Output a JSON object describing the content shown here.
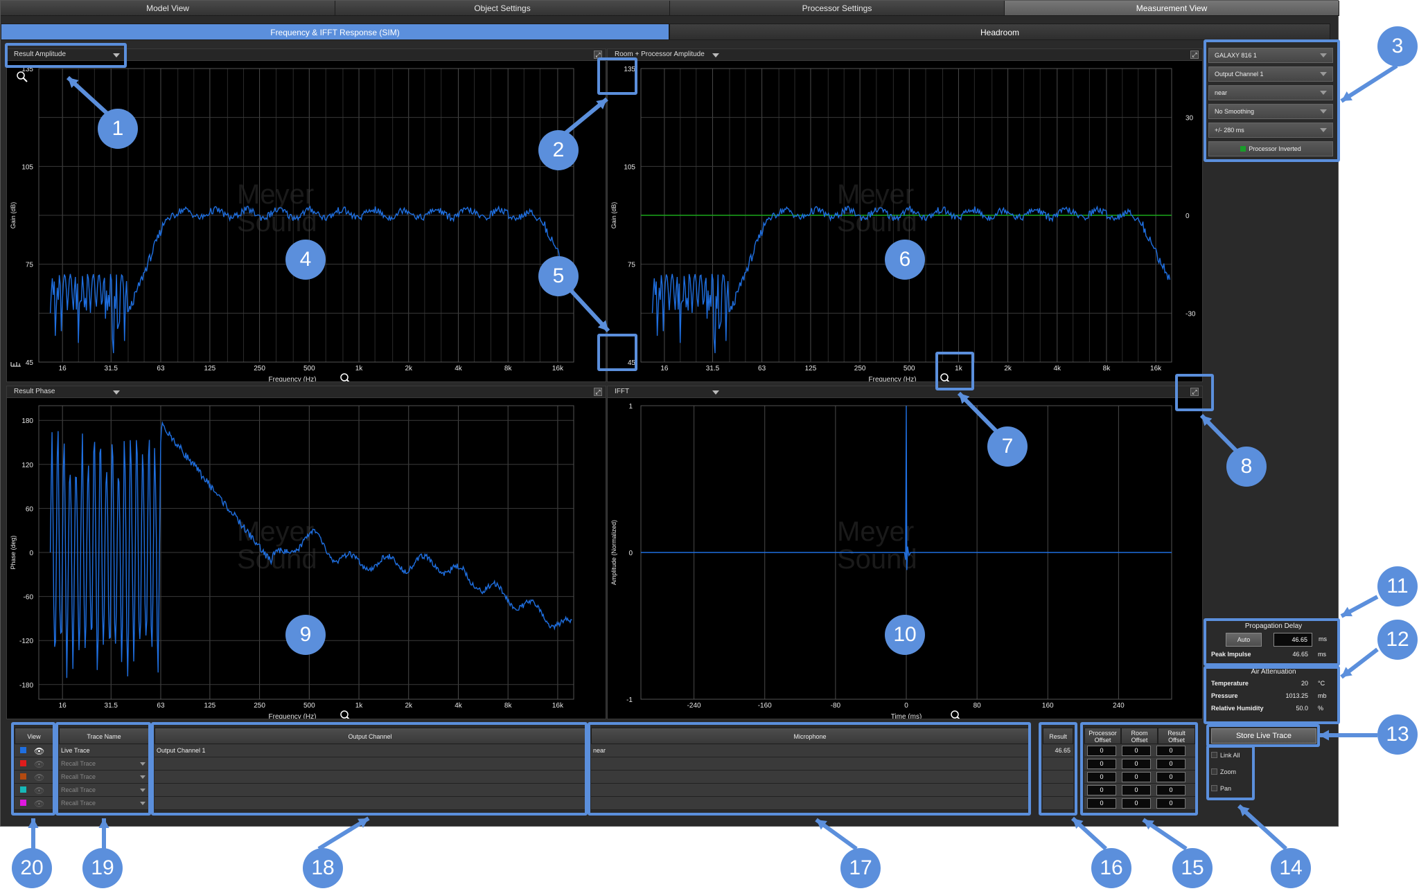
{
  "top_tabs": [
    "Model View",
    "Object Settings",
    "Processor Settings",
    "Measurement View"
  ],
  "sub_tabs": [
    "Frequency & IFFT Response (SIM)",
    "Headroom"
  ],
  "panels": {
    "result_amplitude": {
      "title": "Result Amplitude",
      "ylabel": "Gain (dB)",
      "xlabel": "Frequency (Hz)",
      "y_ticks": [
        "135",
        "105",
        "75",
        "45"
      ],
      "x_ticks": [
        "16",
        "31.5",
        "63",
        "125",
        "250",
        "500",
        "1k",
        "2k",
        "4k",
        "8k",
        "16k"
      ]
    },
    "room_processor_amplitude": {
      "title": "Room + Processor Amplitude",
      "ylabel": "Gain (dB)",
      "xlabel": "Frequency (Hz)",
      "y_ticks": [
        "135",
        "105",
        "75",
        "45"
      ],
      "y2_ticks": [
        "30",
        "0",
        "-30"
      ],
      "x_ticks": [
        "16",
        "31.5",
        "63",
        "125",
        "250",
        "500",
        "1k",
        "2k",
        "4k",
        "8k",
        "16k"
      ]
    },
    "result_phase": {
      "title": "Result Phase",
      "ylabel": "Phase (deg)",
      "xlabel": "Frequency (Hz)",
      "y_ticks": [
        "180",
        "120",
        "60",
        "0",
        "-60",
        "-120",
        "-180"
      ],
      "x_ticks": [
        "16",
        "31.5",
        "63",
        "125",
        "250",
        "500",
        "1k",
        "2k",
        "4k",
        "8k",
        "16k"
      ]
    },
    "ifft": {
      "title": "IFFT",
      "ylabel": "Amplitude (Normalized)",
      "xlabel": "Time (ms)",
      "y_ticks": [
        "1",
        "0",
        "-1"
      ],
      "x_ticks": [
        "-240",
        "-160",
        "-80",
        "0",
        "80",
        "160",
        "240"
      ]
    }
  },
  "watermark": {
    "line1": "Meyer",
    "line2": "Sound"
  },
  "side_controls": {
    "dropdowns": [
      "GALAXY 816 1",
      "Output Channel 1",
      "near",
      "No Smoothing",
      "+/- 280 ms"
    ],
    "processor_inverted": "Processor Inverted",
    "processor_inverted_color": "#1a9c2a"
  },
  "propagation_delay": {
    "title": "Propagation Delay",
    "auto_label": "Auto",
    "value": "46.65",
    "unit": "ms",
    "peak_label": "Peak Impulse",
    "peak_value": "46.65",
    "peak_unit": "ms"
  },
  "air_attenuation": {
    "title": "Air Attenuation",
    "temperature_label": "Temperature",
    "temperature_value": "20",
    "temperature_unit": "°C",
    "pressure_label": "Pressure",
    "pressure_value": "1013.25",
    "pressure_unit": "mb",
    "humidity_label": "Relative Humidity",
    "humidity_value": "50.0",
    "humidity_unit": "%"
  },
  "store_live_trace": "Store Live Trace",
  "link_options": [
    "Link All",
    "Zoom",
    "Pan"
  ],
  "trace_table": {
    "headers": {
      "view": "View",
      "trace_name": "Trace Name",
      "output_channel": "Output Channel",
      "microphone": "Microphone",
      "result": "Result",
      "processor_offset": [
        "Processor",
        "Offset"
      ],
      "room_offset": [
        "Room",
        "Offset"
      ],
      "result_offset": [
        "Result",
        "Offset"
      ]
    },
    "rows": [
      {
        "color": "#1f6fe0",
        "name": "Live Trace",
        "output": "Output Channel 1",
        "mic": "near",
        "result": "46.65",
        "p": "0",
        "r": "0",
        "ro": "0"
      },
      {
        "color": "#e01c1c",
        "name": "Recall Trace",
        "output": "",
        "mic": "",
        "result": "",
        "p": "0",
        "r": "0",
        "ro": "0"
      },
      {
        "color": "#b34a10",
        "name": "Recall Trace",
        "output": "",
        "mic": "",
        "result": "",
        "p": "0",
        "r": "0",
        "ro": "0"
      },
      {
        "color": "#17b8b8",
        "name": "Recall Trace",
        "output": "",
        "mic": "",
        "result": "",
        "p": "0",
        "r": "0",
        "ro": "0"
      },
      {
        "color": "#e018e0",
        "name": "Recall Trace",
        "output": "",
        "mic": "",
        "result": "",
        "p": "0",
        "r": "0",
        "ro": "0"
      }
    ]
  },
  "callouts": [
    "1",
    "2",
    "3",
    "4",
    "5",
    "6",
    "7",
    "8",
    "9",
    "10",
    "11",
    "12",
    "13",
    "14",
    "15",
    "16",
    "17",
    "18",
    "19",
    "20"
  ],
  "colors": {
    "accent": "#5b8fdc",
    "trace": "#1f6fe0",
    "reference_line": "#1aa81a"
  }
}
